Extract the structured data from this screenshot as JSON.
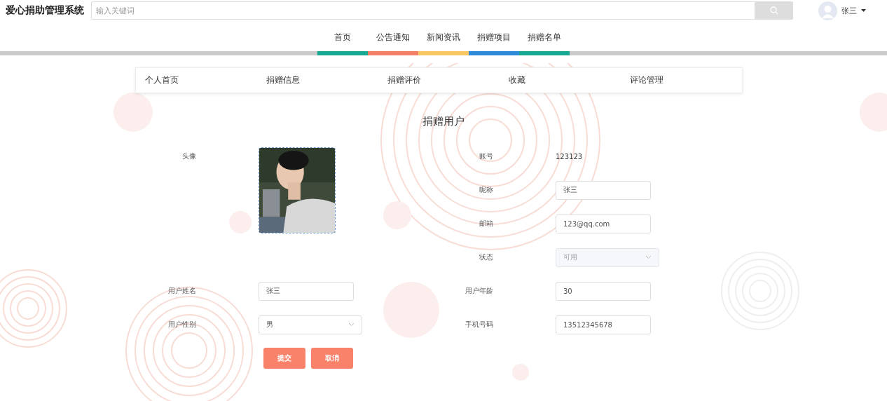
{
  "app": {
    "title": "爱心捐助管理系统"
  },
  "search": {
    "placeholder": "输入关键词"
  },
  "user": {
    "name": "张三"
  },
  "nav": [
    {
      "label": "首页",
      "color": "#17a894"
    },
    {
      "label": "公告通知",
      "color": "#f47f68"
    },
    {
      "label": "新闻资讯",
      "color": "#fbc765"
    },
    {
      "label": "捐赠项目",
      "color": "#2e8ad8"
    },
    {
      "label": "捐赠名单",
      "color": "#17a894"
    }
  ],
  "subnav": [
    {
      "label": "个人首页"
    },
    {
      "label": "捐赠信息"
    },
    {
      "label": "捐赠评价"
    },
    {
      "label": "收藏"
    },
    {
      "label": "评论管理"
    }
  ],
  "form": {
    "title": "捐赠用户",
    "left_fields": [
      {
        "kind": "avatar",
        "label": "头像"
      },
      {
        "kind": "input",
        "label": "用户姓名",
        "value": "张三"
      },
      {
        "kind": "select",
        "label": "用户性别",
        "value": "男",
        "disabled": false
      }
    ],
    "right_fields": [
      {
        "kind": "text",
        "label": "账号",
        "value": "123123"
      },
      {
        "kind": "input",
        "label": "昵称",
        "value": "张三"
      },
      {
        "kind": "input",
        "label": "邮箱",
        "value": "123@qq.com"
      },
      {
        "kind": "select",
        "label": "状态",
        "value": "可用",
        "disabled": true
      },
      {
        "kind": "input",
        "label": "用户年龄",
        "value": "30"
      },
      {
        "kind": "input",
        "label": "手机号码",
        "value": "13512345678"
      }
    ],
    "buttons": [
      {
        "label": "提交"
      },
      {
        "label": "取消"
      }
    ]
  }
}
